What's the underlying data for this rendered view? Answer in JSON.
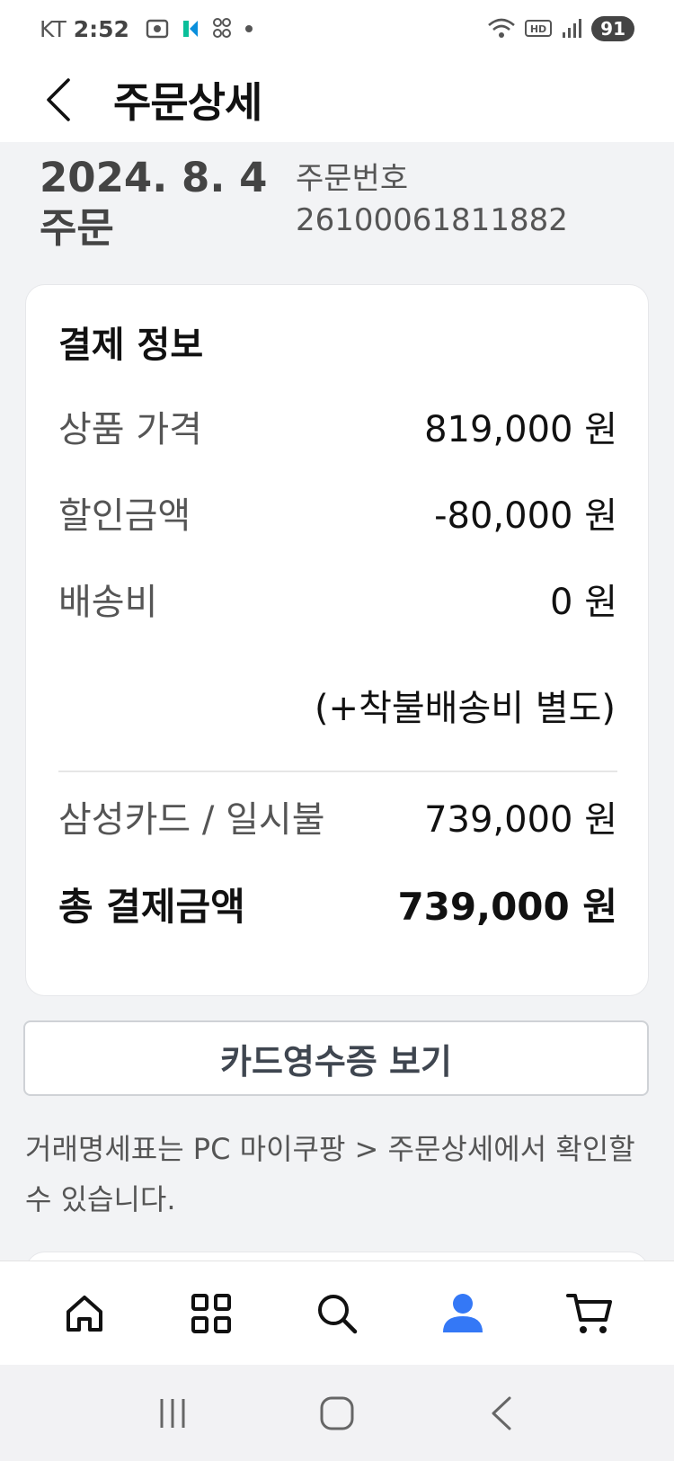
{
  "status_bar": {
    "carrier": "KT",
    "time": "2:52",
    "battery": "91"
  },
  "header": {
    "title": "주문상세"
  },
  "order": {
    "date_line1": "2024. 8. 4",
    "date_line2": "주문",
    "number_label": "주문번호",
    "number": "26100061811882"
  },
  "payment": {
    "title": "결제 정보",
    "rows": [
      {
        "label": "상품 가격",
        "value": "819,000 원"
      },
      {
        "label": "할인금액",
        "value": "-80,000 원"
      },
      {
        "label": "배송비",
        "value": "0 원"
      }
    ],
    "shipping_note": "(+착불배송비 별도)",
    "method_label": "삼성카드 / 일시불",
    "method_value": "739,000 원",
    "total_label": "총 결제금액",
    "total_value": "739,000 원"
  },
  "receipt_button": "카드영수증 보기",
  "info_text": "거래명세표는 PC 마이쿠팡 > 주문상세에서 확인할 수 있습니다.",
  "nav": {
    "active_color": "#3478f6",
    "icon_color": "#111111",
    "items": [
      "home-icon",
      "category-icon",
      "search-icon",
      "my-page-icon",
      "cart-icon"
    ]
  }
}
